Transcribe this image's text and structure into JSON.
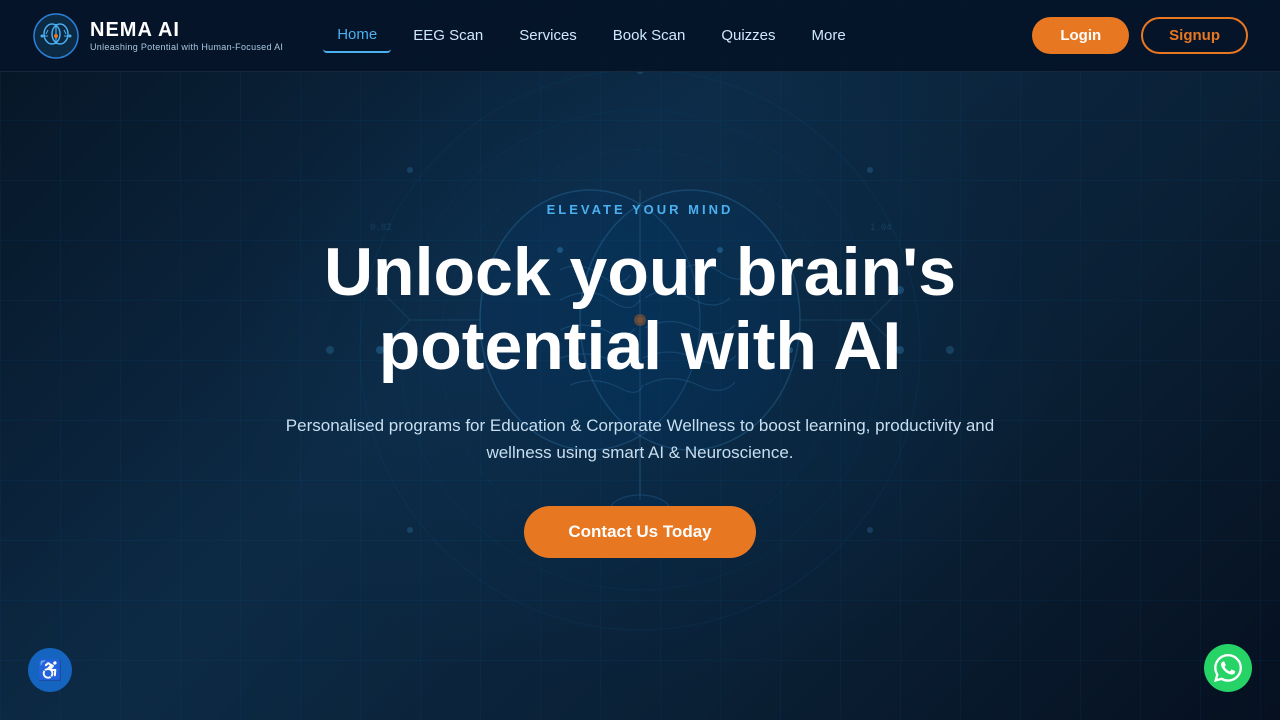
{
  "site": {
    "name": "NEMA AI",
    "tagline": "Unleashing Potential with Human-Focused AI"
  },
  "navbar": {
    "links": [
      {
        "label": "Home",
        "active": true
      },
      {
        "label": "EEG Scan",
        "active": false
      },
      {
        "label": "Services",
        "active": false
      },
      {
        "label": "Book Scan",
        "active": false
      },
      {
        "label": "Quizzes",
        "active": false
      },
      {
        "label": "More",
        "active": false
      }
    ],
    "login_label": "Login",
    "signup_label": "Signup"
  },
  "hero": {
    "eyebrow": "ELEVATE YOUR MIND",
    "title": "Unlock your brain's potential with AI",
    "subtitle": "Personalised programs for Education & Corporate Wellness to boost learning, productivity and wellness using smart AI & Neuroscience.",
    "cta_label": "Contact Us Today"
  },
  "accessibility": {
    "icon": "♿"
  },
  "whatsapp": {
    "icon": "💬"
  }
}
